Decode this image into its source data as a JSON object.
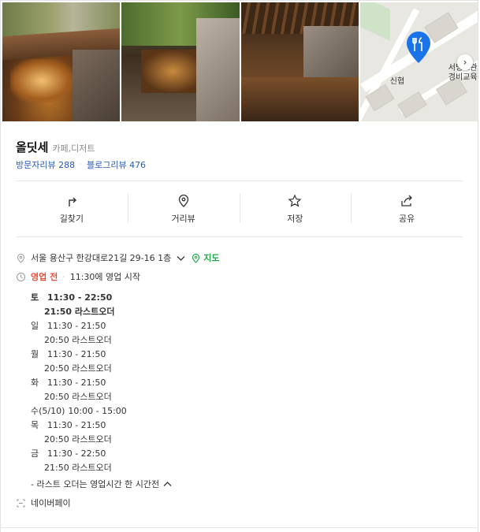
{
  "place": {
    "name": "올딧세",
    "category": "카페,디저트",
    "visitor_reviews": "방문자리뷰 288",
    "blog_reviews": "블로그리뷰 476"
  },
  "map": {
    "labels": [
      "신협",
      "서빙고관",
      "경비교육"
    ],
    "pin_color": "#1a73e8"
  },
  "actions": [
    {
      "label": "길찾기",
      "icon": "directions-icon"
    },
    {
      "label": "거리뷰",
      "icon": "location-pin-icon"
    },
    {
      "label": "저장",
      "icon": "star-icon"
    },
    {
      "label": "공유",
      "icon": "share-icon"
    }
  ],
  "address": {
    "text": "서울 용산구 한강대로21길 29-16 1층",
    "map_link": "지도"
  },
  "status": {
    "state": "영업 전",
    "detail": "11:30에 영업 시작"
  },
  "hours": [
    {
      "day": "토",
      "time": "11:30 - 22:50",
      "last": "21:50 라스트오더",
      "bold": true
    },
    {
      "day": "일",
      "time": "11:30 - 21:50",
      "last": "20:50 라스트오더",
      "bold": false
    },
    {
      "day": "월",
      "time": "11:30 - 21:50",
      "last": "20:50 라스트오더",
      "bold": false
    },
    {
      "day": "화",
      "time": "11:30 - 21:50",
      "last": "20:50 라스트오더",
      "bold": false
    },
    {
      "day": "수(5/10)",
      "time": "10:00 - 15:00",
      "last": "",
      "bold": false
    },
    {
      "day": "목",
      "time": "11:30 - 21:50",
      "last": "20:50 라스트오더",
      "bold": false
    },
    {
      "day": "금",
      "time": "11:30 - 22:50",
      "last": "21:50 라스트오더",
      "bold": false
    }
  ],
  "hours_note": "- 라스트 오더는 영업시간 한 시간전",
  "payment": "네이버페이",
  "colors": {
    "link": "#2b5bb8",
    "map_link": "#1fa84a",
    "closed": "#e74c3c"
  }
}
